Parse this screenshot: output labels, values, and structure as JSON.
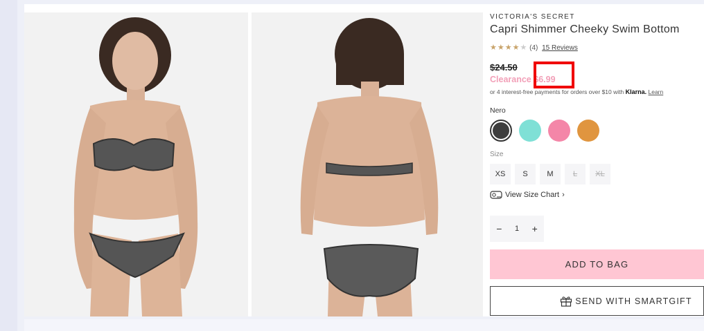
{
  "product": {
    "brand": "VICTORIA'S SECRET",
    "title": "Capri Shimmer Cheeky Swim Bottom",
    "rating_stars": "★★★★",
    "rating_empty_star": "★",
    "rating_value": 4,
    "rating_count": "(4)",
    "reviews_link": "15 Reviews",
    "original_price": "$24.50",
    "clearance_label": "Clearance",
    "clearance_price": "$6.99",
    "klarna_text": "or 4 interest-free payments for orders over $10 with",
    "klarna_logo": "Klarna.",
    "klarna_learn": "Learn"
  },
  "images": {
    "front_icon": "model-front-photo",
    "back_icon": "model-back-photo"
  },
  "color": {
    "selected_name": "Nero",
    "swatches": [
      {
        "name": "Nero",
        "color": "#3e3e3e",
        "selected": true
      },
      {
        "name": "aqua",
        "color": "#7fe0d6",
        "selected": false
      },
      {
        "name": "pink",
        "color": "#f486a8",
        "selected": false
      },
      {
        "name": "orange",
        "color": "#e0953f",
        "selected": false
      }
    ]
  },
  "size": {
    "label": "Size",
    "options": [
      {
        "label": "XS",
        "available": true
      },
      {
        "label": "S",
        "available": true
      },
      {
        "label": "M",
        "available": true
      },
      {
        "label": "L",
        "available": false
      },
      {
        "label": "XL",
        "available": false
      }
    ]
  },
  "size_chart": {
    "icon": "measuring-tape-icon",
    "label": "View Size Chart",
    "chevron": "›"
  },
  "quantity": {
    "minus": "−",
    "value": "1",
    "plus": "+"
  },
  "actions": {
    "add_to_bag": "ADD TO BAG",
    "smartgift_icon": "gift-icon",
    "smartgift": "SEND WITH SMARTGIFT"
  },
  "colors": {
    "clearance": "#f2a0b8",
    "add_to_bag_bg": "#ffc6d3",
    "highlight_box": "#f00000",
    "star": "#c8a36a"
  }
}
